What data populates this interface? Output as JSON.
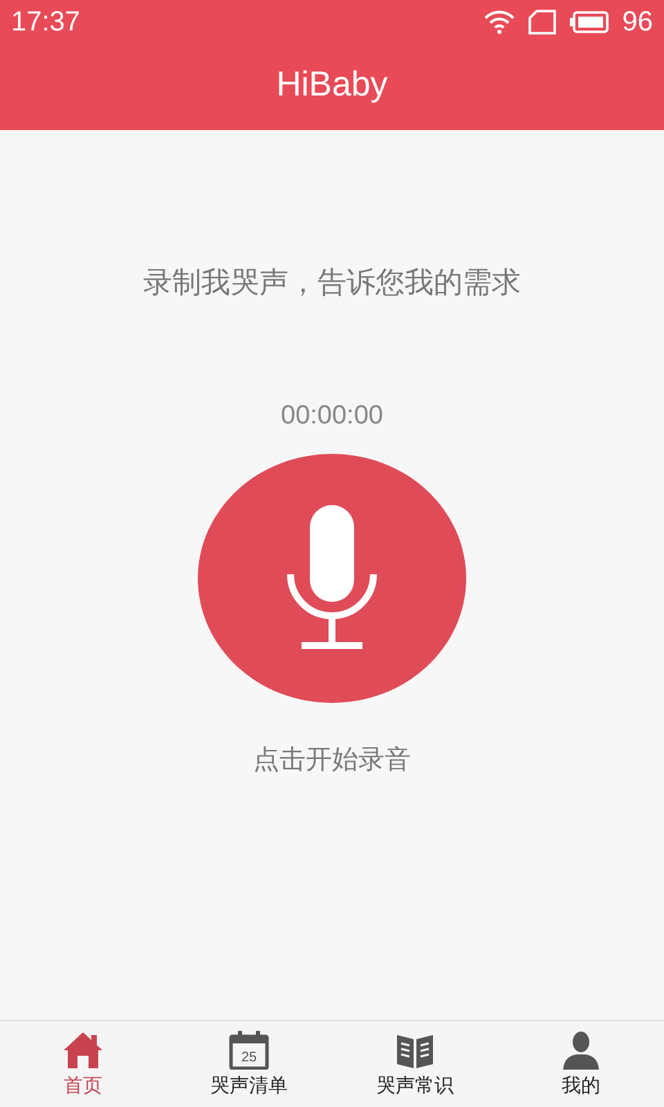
{
  "status_bar": {
    "time": "17:37",
    "battery": "96"
  },
  "header": {
    "title": "HiBaby"
  },
  "record": {
    "prompt": "录制我哭声，告诉您我的需求",
    "timer": "00:00:00",
    "hint": "点击开始录音"
  },
  "tabs": [
    {
      "kind": "home",
      "label": "首页",
      "selected": true
    },
    {
      "kind": "calendar",
      "label": "哭声清单",
      "selected": false,
      "icon_text": "25"
    },
    {
      "kind": "book",
      "label": "哭声常识",
      "selected": false
    },
    {
      "kind": "person",
      "label": "我的",
      "selected": false
    }
  ]
}
